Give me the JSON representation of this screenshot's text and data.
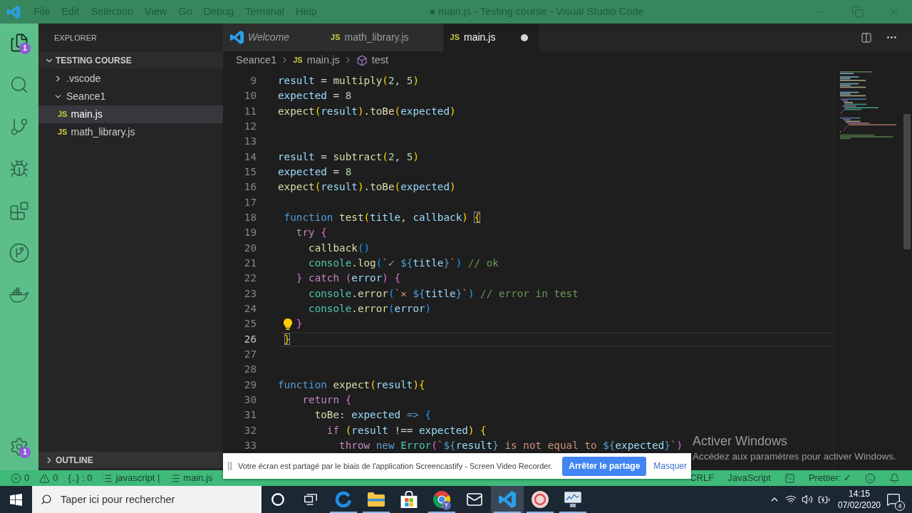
{
  "title_bar": {
    "menu": [
      "File",
      "Edit",
      "Selection",
      "View",
      "Go",
      "Debug",
      "Terminal",
      "Help"
    ],
    "title": "● main.js - Testing course - Visual Studio Code"
  },
  "activity_bar": {
    "items": [
      {
        "kind": "files",
        "selected": true,
        "badge": "1"
      },
      {
        "kind": "search",
        "selected": false
      },
      {
        "kind": "source_control",
        "selected": false
      },
      {
        "kind": "debug",
        "selected": false
      },
      {
        "kind": "extensions",
        "selected": false
      },
      {
        "kind": "history",
        "selected": false
      },
      {
        "kind": "docker",
        "selected": false
      }
    ],
    "manage": {
      "badge": "1"
    }
  },
  "sidebar": {
    "title": "EXPLORER",
    "sections": [
      {
        "title": "TESTING COURSE",
        "expanded": true,
        "items": [
          {
            "kind": "folder",
            "label": ".vscode",
            "expanded": false,
            "selected": false
          },
          {
            "kind": "folder",
            "label": "Seance1",
            "expanded": true,
            "selected": false,
            "children": [
              {
                "kind": "file",
                "icon": "JS",
                "label": "main.js",
                "selected": true
              },
              {
                "kind": "file",
                "icon": "JS",
                "label": "math_library.js",
                "selected": false
              }
            ]
          }
        ]
      },
      {
        "title": "OUTLINE",
        "expanded": false
      }
    ]
  },
  "editor": {
    "tabs": [
      {
        "kind": "welcome",
        "label": "Welcome",
        "preview": true,
        "selected": false,
        "modified": false
      },
      {
        "kind": "file",
        "icon": "JS",
        "label": "math_library.js",
        "preview": false,
        "selected": false,
        "modified": false
      },
      {
        "kind": "file",
        "icon": "JS",
        "label": "main.js",
        "preview": false,
        "selected": true,
        "modified": true
      }
    ],
    "breadcrumb": [
      {
        "kind": "folder",
        "label": "Seance1"
      },
      {
        "kind": "file",
        "icon": "JS",
        "label": "main.js"
      },
      {
        "kind": "symbol",
        "label": "test"
      }
    ],
    "lines": [
      {
        "number": "9",
        "current": false,
        "lightbulb": false,
        "tokens": [
          {
            "kind": "variable",
            "text": "result"
          },
          {
            "kind": "plain",
            "text": " = "
          },
          {
            "kind": "function",
            "text": "multiply"
          },
          {
            "kind": "bracket1",
            "text": "("
          },
          {
            "kind": "number",
            "text": "2"
          },
          {
            "kind": "plain",
            "text": ", "
          },
          {
            "kind": "number",
            "text": "5"
          },
          {
            "kind": "bracket1",
            "text": ")"
          }
        ]
      },
      {
        "number": "10",
        "current": false,
        "lightbulb": false,
        "tokens": [
          {
            "kind": "variable",
            "text": "expected"
          },
          {
            "kind": "plain",
            "text": " = "
          },
          {
            "kind": "number",
            "text": "8"
          }
        ]
      },
      {
        "number": "11",
        "current": false,
        "lightbulb": false,
        "tokens": [
          {
            "kind": "function",
            "text": "expect"
          },
          {
            "kind": "bracket1",
            "text": "("
          },
          {
            "kind": "variable",
            "text": "result"
          },
          {
            "kind": "bracket1",
            "text": ")"
          },
          {
            "kind": "plain",
            "text": "."
          },
          {
            "kind": "function",
            "text": "toBe"
          },
          {
            "kind": "bracket1",
            "text": "("
          },
          {
            "kind": "variable",
            "text": "expected"
          },
          {
            "kind": "bracket1",
            "text": ")"
          }
        ]
      },
      {
        "number": "12",
        "current": false,
        "lightbulb": false
      },
      {
        "number": "13",
        "current": false,
        "lightbulb": false
      },
      {
        "number": "14",
        "current": false,
        "lightbulb": false,
        "tokens": [
          {
            "kind": "variable",
            "text": "result"
          },
          {
            "kind": "plain",
            "text": " = "
          },
          {
            "kind": "function",
            "text": "subtract"
          },
          {
            "kind": "bracket1",
            "text": "("
          },
          {
            "kind": "number",
            "text": "2"
          },
          {
            "kind": "plain",
            "text": ", "
          },
          {
            "kind": "number",
            "text": "5"
          },
          {
            "kind": "bracket1",
            "text": ")"
          }
        ]
      },
      {
        "number": "15",
        "current": false,
        "lightbulb": false,
        "tokens": [
          {
            "kind": "variable",
            "text": "expected"
          },
          {
            "kind": "plain",
            "text": " = "
          },
          {
            "kind": "number",
            "text": "8"
          }
        ]
      },
      {
        "number": "16",
        "current": false,
        "lightbulb": false,
        "tokens": [
          {
            "kind": "function",
            "text": "expect"
          },
          {
            "kind": "bracket1",
            "text": "("
          },
          {
            "kind": "variable",
            "text": "result"
          },
          {
            "kind": "bracket1",
            "text": ")"
          },
          {
            "kind": "plain",
            "text": "."
          },
          {
            "kind": "function",
            "text": "toBe"
          },
          {
            "kind": "bracket1",
            "text": "("
          },
          {
            "kind": "variable",
            "text": "expected"
          },
          {
            "kind": "bracket1",
            "text": ")"
          }
        ]
      },
      {
        "number": "17",
        "current": false,
        "lightbulb": false
      },
      {
        "number": "18",
        "current": false,
        "lightbulb": false,
        "tokens": [
          {
            "kind": "storage",
            "text": " function "
          },
          {
            "kind": "function",
            "text": "test"
          },
          {
            "kind": "bracket1",
            "text": "("
          },
          {
            "kind": "variable",
            "text": "title"
          },
          {
            "kind": "plain",
            "text": ", "
          },
          {
            "kind": "variable",
            "text": "callback"
          },
          {
            "kind": "bracket1",
            "text": ") "
          },
          {
            "kind": "bracket_match",
            "text": "{"
          }
        ]
      },
      {
        "number": "19",
        "current": false,
        "lightbulb": false,
        "tokens": [
          {
            "kind": "keyword",
            "text": "   try "
          },
          {
            "kind": "bracket2",
            "text": "{"
          }
        ]
      },
      {
        "number": "20",
        "current": false,
        "lightbulb": false,
        "tokens": [
          {
            "kind": "function",
            "text": "     callback"
          },
          {
            "kind": "bracket3",
            "text": "()"
          }
        ]
      },
      {
        "number": "21",
        "current": false,
        "lightbulb": false,
        "tokens": [
          {
            "kind": "type",
            "text": "     console"
          },
          {
            "kind": "plain",
            "text": "."
          },
          {
            "kind": "function",
            "text": "log"
          },
          {
            "kind": "bracket3",
            "text": "("
          },
          {
            "kind": "string",
            "text": "`✓ "
          },
          {
            "kind": "storage",
            "text": "${"
          },
          {
            "kind": "variable",
            "text": "title"
          },
          {
            "kind": "storage",
            "text": "}"
          },
          {
            "kind": "string",
            "text": "`"
          },
          {
            "kind": "bracket3",
            "text": ") "
          },
          {
            "kind": "comment",
            "text": "// ok"
          }
        ]
      },
      {
        "number": "22",
        "current": false,
        "lightbulb": false,
        "tokens": [
          {
            "kind": "bracket2",
            "text": "   } "
          },
          {
            "kind": "keyword",
            "text": "catch "
          },
          {
            "kind": "bracket2",
            "text": "("
          },
          {
            "kind": "variable",
            "text": "error"
          },
          {
            "kind": "bracket2",
            "text": ") {"
          }
        ]
      },
      {
        "number": "23",
        "current": false,
        "lightbulb": false,
        "tokens": [
          {
            "kind": "type",
            "text": "     console"
          },
          {
            "kind": "plain",
            "text": "."
          },
          {
            "kind": "function",
            "text": "error"
          },
          {
            "kind": "bracket3",
            "text": "("
          },
          {
            "kind": "string",
            "text": "`✕ "
          },
          {
            "kind": "storage",
            "text": "${"
          },
          {
            "kind": "variable",
            "text": "title"
          },
          {
            "kind": "storage",
            "text": "}"
          },
          {
            "kind": "string",
            "text": "`"
          },
          {
            "kind": "bracket3",
            "text": ") "
          },
          {
            "kind": "comment",
            "text": "// error in test"
          }
        ]
      },
      {
        "number": "24",
        "current": false,
        "lightbulb": false,
        "tokens": [
          {
            "kind": "type",
            "text": "     console"
          },
          {
            "kind": "plain",
            "text": "."
          },
          {
            "kind": "function",
            "text": "error"
          },
          {
            "kind": "bracket3",
            "text": "("
          },
          {
            "kind": "variable",
            "text": "error"
          },
          {
            "kind": "bracket3",
            "text": ")"
          }
        ]
      },
      {
        "number": "25",
        "current": false,
        "lightbulb": true,
        "tokens": [
          {
            "kind": "bracket2",
            "text": "   }"
          }
        ]
      },
      {
        "number": "26",
        "current": true,
        "lightbulb": false,
        "tokens": [
          {
            "kind": "bracket_match",
            "text": " }"
          }
        ]
      },
      {
        "number": "27",
        "current": false,
        "lightbulb": false
      },
      {
        "number": "28",
        "current": false,
        "lightbulb": false
      },
      {
        "number": "29",
        "current": false,
        "lightbulb": false,
        "tokens": [
          {
            "kind": "storage",
            "text": "function "
          },
          {
            "kind": "function",
            "text": "expect"
          },
          {
            "kind": "bracket1",
            "text": "("
          },
          {
            "kind": "variable",
            "text": "result"
          },
          {
            "kind": "bracket1",
            "text": "){"
          }
        ]
      },
      {
        "number": "30",
        "current": false,
        "lightbulb": false,
        "tokens": [
          {
            "kind": "keyword",
            "text": "    return "
          },
          {
            "kind": "bracket2",
            "text": "{"
          }
        ]
      },
      {
        "number": "31",
        "current": false,
        "lightbulb": false,
        "tokens": [
          {
            "kind": "function",
            "text": "      toBe"
          },
          {
            "kind": "plain",
            "text": ": "
          },
          {
            "kind": "variable",
            "text": "expected "
          },
          {
            "kind": "storage",
            "text": "=> "
          },
          {
            "kind": "bracket3",
            "text": "{"
          }
        ]
      },
      {
        "number": "32",
        "current": false,
        "lightbulb": false,
        "tokens": [
          {
            "kind": "keyword",
            "text": "        if "
          },
          {
            "kind": "bracket1",
            "text": "("
          },
          {
            "kind": "variable",
            "text": "result"
          },
          {
            "kind": "plain",
            "text": " !== "
          },
          {
            "kind": "variable",
            "text": "expected"
          },
          {
            "kind": "bracket1",
            "text": ") {"
          }
        ]
      },
      {
        "number": "33",
        "current": false,
        "lightbulb": false,
        "tokens": [
          {
            "kind": "keyword",
            "text": "          throw "
          },
          {
            "kind": "storage",
            "text": "new "
          },
          {
            "kind": "type",
            "text": "Error"
          },
          {
            "kind": "bracket2",
            "text": "("
          },
          {
            "kind": "string",
            "text": "`"
          },
          {
            "kind": "storage",
            "text": "${"
          },
          {
            "kind": "variable",
            "text": "result"
          },
          {
            "kind": "storage",
            "text": "}"
          },
          {
            "kind": "string",
            "text": " is not equal to "
          },
          {
            "kind": "storage",
            "text": "${"
          },
          {
            "kind": "variable",
            "text": "expected"
          },
          {
            "kind": "storage",
            "text": "}"
          },
          {
            "kind": "string",
            "text": "`"
          },
          {
            "kind": "bracket2",
            "text": ")"
          }
        ]
      }
    ]
  },
  "notification": {
    "message": "Votre écran est partagé par le biais de l'application Screencastify - Screen Video Recorder.",
    "buttons": [
      {
        "kind": "primary",
        "label": "Arrêter le partage"
      },
      {
        "kind": "link",
        "label": "Masquer"
      }
    ]
  },
  "activation_notice": {
    "title": "Activer Windows",
    "text": "Accédez aux paramètres pour activer Windows."
  },
  "status_bar": {
    "left": [
      {
        "kind": "errors",
        "text": "0"
      },
      {
        "kind": "warnings",
        "text": "0"
      },
      {
        "kind": "plain",
        "text": "{..} : 0"
      },
      {
        "kind": "list",
        "text": "javascript |"
      },
      {
        "kind": "list",
        "text": "main.js"
      }
    ],
    "right": [
      {
        "kind": "plain",
        "text": "CRLF"
      },
      {
        "kind": "plain",
        "text": "JavaScript"
      },
      {
        "kind": "terminal"
      },
      {
        "kind": "plain",
        "text": "Prettier: ✓"
      },
      {
        "kind": "feedback"
      },
      {
        "kind": "bell"
      }
    ]
  },
  "taskbar": {
    "search": {
      "placeholder": "Taper ici pour rechercher"
    },
    "apps": [
      {
        "kind": "swirl",
        "running": true,
        "selected": false
      },
      {
        "kind": "folder",
        "running": true,
        "selected": false
      },
      {
        "kind": "store",
        "running": false,
        "selected": false
      },
      {
        "kind": "ball",
        "running": true,
        "selected": false,
        "badge": "Y"
      },
      {
        "kind": "mail",
        "running": false,
        "selected": false
      },
      {
        "kind": "editor",
        "running": true,
        "selected": true
      },
      {
        "kind": "disc",
        "running": true,
        "selected": false
      },
      {
        "kind": "monitor",
        "running": true,
        "selected": false
      }
    ],
    "clock": {
      "time": "14:15",
      "date": "07/02/2020"
    },
    "notifications": "4"
  }
}
